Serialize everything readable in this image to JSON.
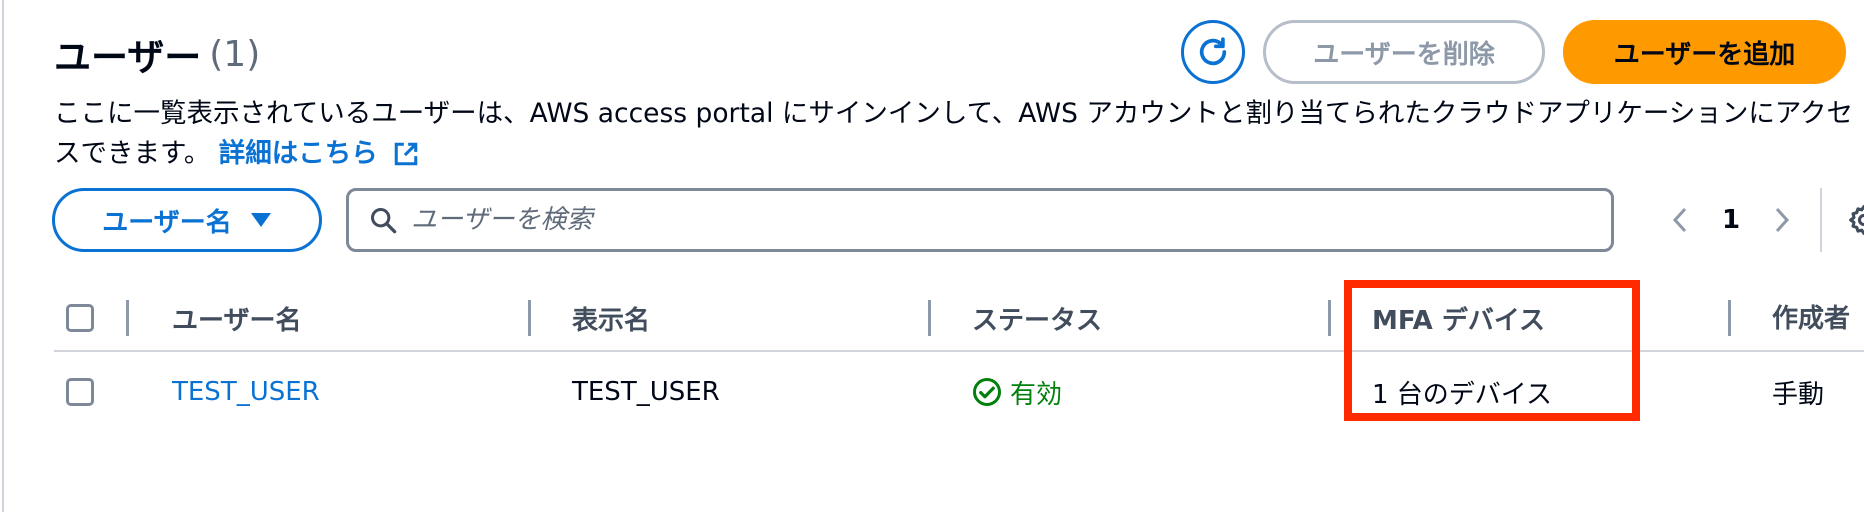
{
  "header": {
    "title": "ユーザー",
    "count": "(1)",
    "refresh_icon": "refresh-icon",
    "delete_button": "ユーザーを削除",
    "add_button": "ユーザーを追加"
  },
  "description": {
    "text": "ここに一覧表示されているユーザーは、AWS access portal にサインインして、AWS アカウントと割り当てられたクラウドアプリケーションにアクセスできます。",
    "link": "詳細はこちら",
    "link_icon": "external-link-icon"
  },
  "filter": {
    "property_label": "ユーザー名",
    "search_placeholder": "ユーザーを検索"
  },
  "pagination": {
    "current_page": "1"
  },
  "table": {
    "columns": [
      "ユーザー名",
      "表示名",
      "ステータス",
      "MFA デバイス",
      "作成者"
    ],
    "rows": [
      {
        "username": "TEST_USER",
        "display_name": "TEST_USER",
        "status": "有効",
        "mfa": "1 台のデバイス",
        "created_by": "手動"
      }
    ]
  },
  "colors": {
    "accent": "#0972d3",
    "primary_button": "#ff9900",
    "success": "#037f0c",
    "highlight": "#ff2a00"
  }
}
